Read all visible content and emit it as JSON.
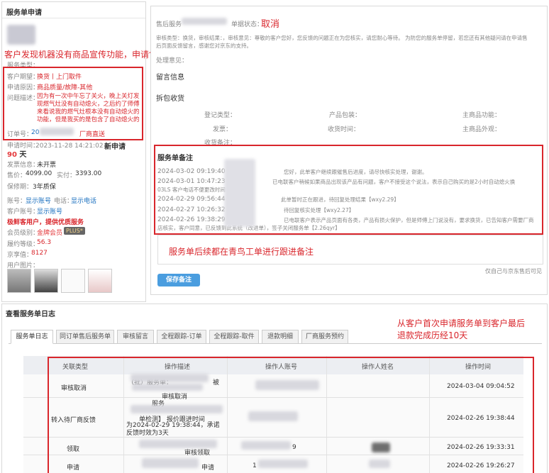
{
  "left": {
    "title": "服务单申请",
    "annotation": "客户发现机器没有商品宣传功能，申请售后处理",
    "service_type_label": "服务类型：",
    "contact_label": "客户期望：",
    "contact_value": "换货丨上门取件",
    "reason_label": "申请原因：",
    "reason_value": "商品质量/故障-其他",
    "problem_label": "问题描述：",
    "problem_value": "因为有一次中午忘了关火，晚上关灯发现燃气灶没有自动熄火，之后约了师傅来看说我的燃气灶根本没有自动熄火的功能，但是我买的是包含了自动熄火的",
    "order_label": "订单号：",
    "order_prefix": "20",
    "order_tag": "厂商直送",
    "apply_time_label": "申请时间：",
    "apply_time_value": "2023-11-28 14:21:02丨",
    "new_label": "新申请",
    "days_value": "90",
    "days_unit": "天",
    "invoice_label": "发票信息：",
    "invoice_value": "未开票",
    "price_label": "售价：",
    "price_value": "4099.00",
    "paid_label": "实付：",
    "paid_value": "3393.00",
    "warranty_label": "保修期：",
    "warranty_value": "3年质保",
    "account_label": "账号：",
    "account_link": "显示账号",
    "phone_label": "电话：",
    "phone_link": "显示电话",
    "customer_label": "客户账号：",
    "customer_link": "显示账号",
    "vip_text": "极鲜客用户，提供优质服务",
    "member_label": "会员级别：",
    "member_value": "金牌会员",
    "plus_badge": "PLUS*",
    "score_label": "履约等级：",
    "score_value": "56.3",
    "jd_label": "京享值：",
    "jd_value": "8127",
    "images_label": "用户图片："
  },
  "right": {
    "service_no_label": "售后服务",
    "status_label": "单据状态：",
    "status_value": "取消",
    "audit_text_1": "审核类型：换货，审核结果：，审核意见：尊敬的客户您好，您反馈的问题正在为您核实，请您耐心等待。 为防您的服务单停留，若您还有其他疑问请在申请售",
    "audit_text_2": "后页面反馈留言，感谢您对京东的支持。",
    "process_label": "处理意见：",
    "notes_left": "留言信息",
    "unpack_title": "拆包收货",
    "reg_type": "登记类型：",
    "goods_pack": "产品包装：",
    "main_func": "主商品功能：",
    "invoice": "发票：",
    "recv_time": "收货时间：",
    "main_look": "主商品外观：",
    "recv_note": "收货备注：",
    "remarks_title": "服务单备注",
    "remarks": [
      {
        "time": "2024-03-02 09:19:40",
        "text": "您好，此单客户继续跟催售后进度，请尽快核实处理，谢谢。"
      },
      {
        "time": "2024-03-01 10:47:23",
        "text": "已电联客户稍候如果商品出现该产品有问题，客户不接受这个说法，表示自己购买的是2小时自动熄火换"
      },
      {
        "time": "",
        "text": "03LS 客户电话不便更改时间"
      },
      {
        "time": "2024-02-29 09:56:44",
        "text": "此单暂时正在跟进，待回复处理结果【wxy2.29】"
      },
      {
        "time": "2024-02-27 10:26:32",
        "text": "待回复核实处理【wxy2.27】"
      },
      {
        "time": "2024-02-26 19:38:29",
        "text": "已电联客户表示产品页面有各类，产品有损火保护，但是师傅上门说没有，要求换货，已告知客户需要厂商"
      },
      {
        "time": "",
        "text": "店核实，客户同意，已反馈到此系统（改进单），签子关闭服务单【2.26qyr】"
      }
    ],
    "remarks_annotation": "服务单后续都在青鸟工单进行跟进备注",
    "remarks_footer": "仅自己与京东售后可见",
    "save_button": "保存备注"
  },
  "log": {
    "title": "查看服务单日志",
    "annotation_1": "从客户首次申请服务单到客户最后",
    "annotation_2": "退款完成历经10天",
    "tabs": [
      "服务单日志",
      "同订单售后服务单",
      "审核留言",
      "全程跟踪-订单",
      "全程跟踪-取件",
      "退款明细",
      "厂商服务预约"
    ],
    "headers": [
      "关联类型",
      "操作描述",
      "操作人账号",
      "操作人姓名",
      "操作时间"
    ],
    "rows": [
      {
        "type": "审核取消",
        "desc1": "（批）服务单：",
        "desc2": "被",
        "desc3": "审核取消",
        "time": "2024-03-04 09:04:52"
      },
      {
        "type": "转入待厂商反馈",
        "desc1": "服务",
        "desc2": "单检测】 报价跟进时间",
        "desc3": "为2024-02-29 19:38:44，承诺反馈时效为3天",
        "time": "2024-02-26 19:38:44"
      },
      {
        "type": "领取",
        "desc1": "",
        "desc2": "审核领取",
        "desc3": "",
        "time": "2024-02-26 19:33:31"
      },
      {
        "type": "申请",
        "desc1": "",
        "desc2": "申请",
        "desc3": "",
        "time": "2024-02-26 19:26:27"
      }
    ],
    "account_fragment_1": "9",
    "account_fragment_2": "1"
  }
}
